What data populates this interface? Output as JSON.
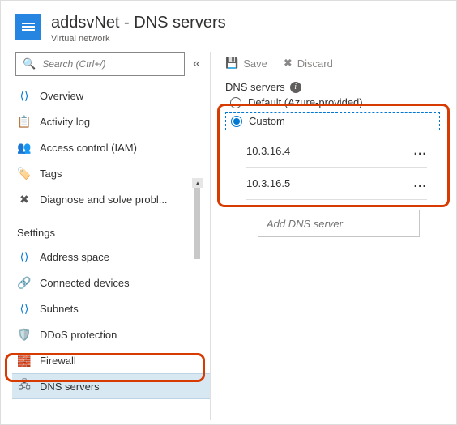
{
  "header": {
    "title": "addsvNet - DNS servers",
    "subtitle": "Virtual network"
  },
  "search": {
    "placeholder": "Search (Ctrl+/)",
    "icon": "search-icon"
  },
  "sidebar": {
    "items": [
      {
        "label": "Overview",
        "icon": "overview-icon"
      },
      {
        "label": "Activity log",
        "icon": "log-icon"
      },
      {
        "label": "Access control (IAM)",
        "icon": "access-icon"
      },
      {
        "label": "Tags",
        "icon": "tags-icon"
      },
      {
        "label": "Diagnose and solve probl...",
        "icon": "diagnose-icon"
      }
    ],
    "settings_header": "Settings",
    "settings": [
      {
        "label": "Address space",
        "icon": "address-icon"
      },
      {
        "label": "Connected devices",
        "icon": "connected-icon"
      },
      {
        "label": "Subnets",
        "icon": "subnets-icon"
      },
      {
        "label": "DDoS protection",
        "icon": "ddos-icon"
      },
      {
        "label": "Firewall",
        "icon": "firewall-icon"
      },
      {
        "label": "DNS servers",
        "icon": "dns-icon",
        "selected": true
      }
    ]
  },
  "toolbar": {
    "save_label": "Save",
    "discard_label": "Discard"
  },
  "dns": {
    "section_label": "DNS servers",
    "opt_default": "Default (Azure-provided)",
    "opt_custom": "Custom",
    "servers": [
      "10.3.16.4",
      "10.3.16.5"
    ],
    "add_placeholder": "Add DNS server"
  }
}
